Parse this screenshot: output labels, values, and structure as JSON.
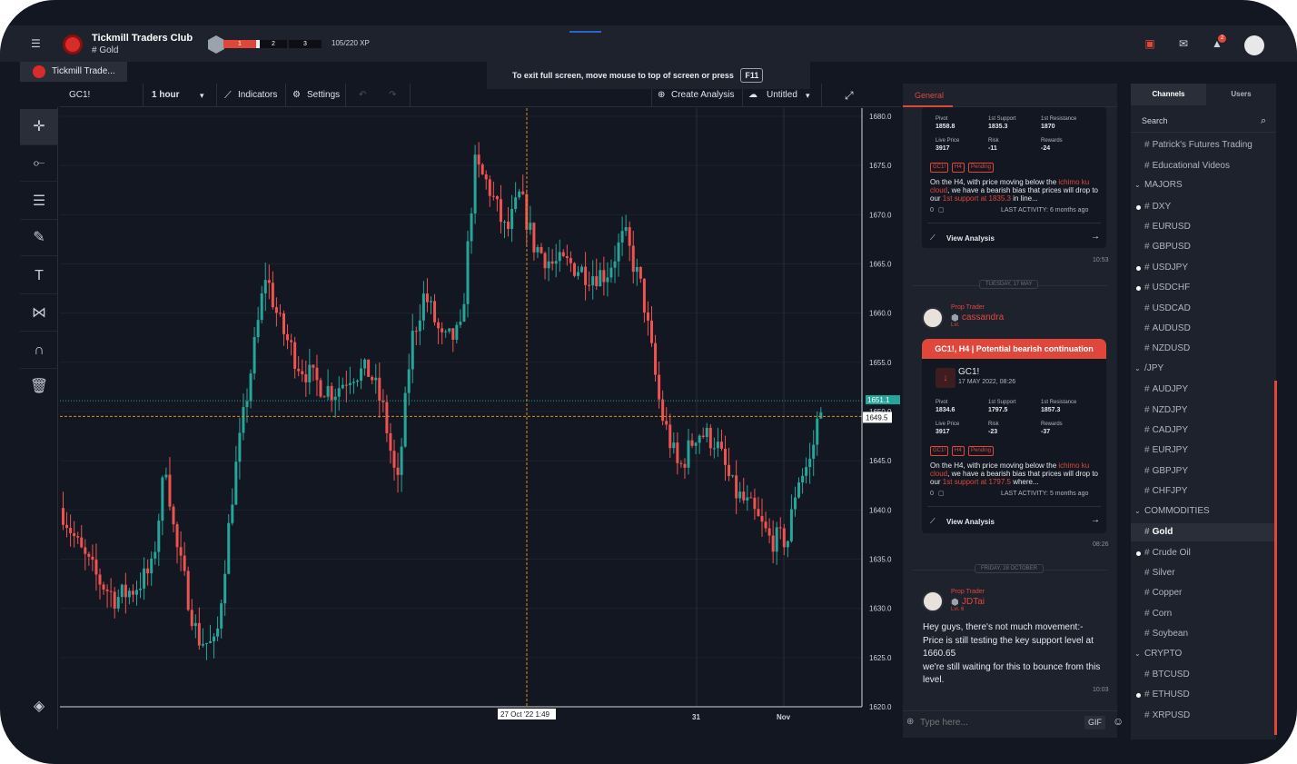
{
  "header": {
    "club_title": "Tickmill Traders Club",
    "channel_subtitle": "# Gold",
    "levels": [
      "1",
      "2",
      "3"
    ],
    "xp": "105/220 XP",
    "notification_count": "2"
  },
  "tabs": {
    "active_tab": "Tickmill Trade..."
  },
  "fullscreen_banner": {
    "text": "To exit full screen, move mouse to top of screen or press",
    "key": "F11"
  },
  "chart_toolbar": {
    "symbol": "GC1!",
    "interval": "1 hour",
    "indicators": "Indicators",
    "settings": "Settings",
    "create_analysis": "Create Analysis",
    "layout": "Untitled"
  },
  "chart_data": {
    "type": "candlestick",
    "symbol": "GC1!",
    "ylim": [
      1620,
      1680
    ],
    "y_ticks": [
      "1680.0",
      "1675.0",
      "1670.0",
      "1665.0",
      "1660.0",
      "1655.0",
      "1650.0",
      "1645.0",
      "1640.0",
      "1635.0",
      "1630.0",
      "1625.0",
      "1620.0"
    ],
    "x_labels": [
      "27 Oct '22 1:49",
      "31",
      "Nov"
    ],
    "last_price": "1651.1",
    "crosshair_price": "1649.5",
    "up_color": "#26a69a",
    "down_color": "#ef5350"
  },
  "chat": {
    "tab_general": "General",
    "card1": {
      "pivot_label": "Pivot",
      "pivot": "1858.8",
      "support_label": "1st Support",
      "support": "1835.3",
      "resistance_label": "1st Resistance",
      "resistance": "1870",
      "live_label": "Live Price",
      "live": "3917",
      "risk_label": "Risk",
      "risk": "-11",
      "rewards_label": "Rewards",
      "rewards": "-24",
      "tags": [
        "GC1!",
        "H4",
        "Pending"
      ],
      "text_a": "On the H4, with price moving below the ",
      "text_b": "ichimo ku cloud",
      "text_c": ", we have a bearish bias that prices will drop to our ",
      "text_d": "1st support at 1835.3",
      "text_e": " in line...",
      "comments": "0",
      "last_activity": "LAST ACTIVITY: 6 months ago",
      "view": "View Analysis"
    },
    "time1": "10:53",
    "date_sep1": "TUESDAY, 17 MAY",
    "post2": {
      "role": "Prop Trader",
      "user": "cassandra",
      "level": "Lvl.",
      "title": "GC1!, H4 | Potential bearish continuation",
      "symbol": "GC1!",
      "date": "17 MAY 2022, 08:26"
    },
    "card2": {
      "pivot_label": "Pivot",
      "pivot": "1834.6",
      "support_label": "1st Support",
      "support": "1797.5",
      "resistance_label": "1st Resistance",
      "resistance": "1857.3",
      "live_label": "Live Price",
      "live": "3917",
      "risk_label": "Risk",
      "risk": "-23",
      "rewards_label": "Rewards",
      "rewards": "-37",
      "tags": [
        "GC1!",
        "H4",
        "Pending"
      ],
      "text_a": "On the H4, with price moving below the ",
      "text_b": "ichimo ku cloud",
      "text_c": ", we have a bearish bias that prices will drop to our ",
      "text_d": "1st support at 1797.5",
      "text_e": " where...",
      "comments": "0",
      "last_activity": "LAST ACTIVITY: 5 months ago",
      "view": "View Analysis"
    },
    "time2": "08:26",
    "date_sep2": "FRIDAY, 28 OCTOBER",
    "post3": {
      "role": "Prop Trader",
      "user": "JDTai",
      "level": "Lvl. 6",
      "lines": [
        "Hey guys, there's not much movement:-",
        "Price is still testing the key support level at",
        "1660.65",
        "we're still waiting for this to bounce from this",
        "level."
      ]
    },
    "time3": "10:03",
    "input_placeholder": "Type here...",
    "gif": "GIF"
  },
  "channels": {
    "tab_channels": "Channels",
    "tab_users": "Users",
    "search": "Search",
    "top": [
      "Patrick's Futures Trading",
      "Educational Videos"
    ],
    "groups": [
      {
        "name": "MAJORS",
        "items": [
          {
            "name": "DXY",
            "unread": true
          },
          {
            "name": "EURUSD",
            "unread": false
          },
          {
            "name": "GBPUSD",
            "unread": false
          },
          {
            "name": "USDJPY",
            "unread": true
          },
          {
            "name": "USDCHF",
            "unread": true
          },
          {
            "name": "USDCAD",
            "unread": false
          },
          {
            "name": "AUDUSD",
            "unread": false
          },
          {
            "name": "NZDUSD",
            "unread": false
          }
        ]
      },
      {
        "name": "/JPY",
        "items": [
          {
            "name": "AUDJPY",
            "unread": false
          },
          {
            "name": "NZDJPY",
            "unread": false
          },
          {
            "name": "CADJPY",
            "unread": false
          },
          {
            "name": "EURJPY",
            "unread": false
          },
          {
            "name": "GBPJPY",
            "unread": false
          },
          {
            "name": "CHFJPY",
            "unread": false
          }
        ]
      },
      {
        "name": "COMMODITIES",
        "items": [
          {
            "name": "Gold",
            "unread": false,
            "active": true
          },
          {
            "name": "Crude Oil",
            "unread": true
          },
          {
            "name": "Silver",
            "unread": false
          },
          {
            "name": "Copper",
            "unread": false
          },
          {
            "name": "Corn",
            "unread": false
          },
          {
            "name": "Soybean",
            "unread": false
          }
        ]
      },
      {
        "name": "CRYPTO",
        "items": [
          {
            "name": "BTCUSD",
            "unread": false
          },
          {
            "name": "ETHUSD",
            "unread": true
          },
          {
            "name": "XRPUSD",
            "unread": false
          }
        ]
      }
    ]
  }
}
